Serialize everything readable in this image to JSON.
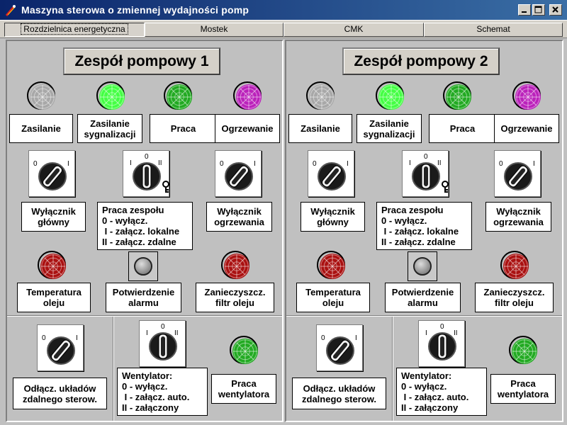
{
  "window": {
    "title": "Maszyna sterowa o zmiennej wydajności pomp"
  },
  "tabs": [
    {
      "label": "Rozdzielnica energetyczna",
      "active": true
    },
    {
      "label": "Mostek",
      "active": false
    },
    {
      "label": "CMK",
      "active": false
    },
    {
      "label": "Schemat",
      "active": false
    }
  ],
  "units": [
    {
      "title": "Zespół pompowy 1",
      "indicators": [
        {
          "label": "Zasilanie",
          "color": "#a8a8a8"
        },
        {
          "label": "Zasilanie sygnalizacji",
          "color": "#44ff44"
        },
        {
          "label": "Praca",
          "color": "#22aa22"
        },
        {
          "label": "Ogrzewanie",
          "color": "#bb22bb"
        }
      ],
      "main_switch_label": "Wyłącznik główny",
      "main_switch_positions": [
        "0",
        "I"
      ],
      "mode_switch_label": "Praca zespołu\n0 - wyłącz.\n I - załącz. lokalne\nII - załącz. zdalne",
      "mode_switch_positions": [
        "I",
        "0",
        "II"
      ],
      "heating_switch_label": "Wyłącznik ogrzewania",
      "heating_switch_positions": [
        "0",
        "I"
      ],
      "alarms": [
        {
          "label": "Temperatura oleju",
          "color": "#aa1111"
        },
        {
          "label": "Potwierdzenie alarmu"
        },
        {
          "label": "Zanieczyszcz. filtr oleju",
          "color": "#aa1111"
        }
      ],
      "remote_switch_label": "Odłącz. układów zdalnego sterow.",
      "remote_switch_positions": [
        "0",
        "I"
      ],
      "fan_switch_label": "Wentylator:\n0 - wyłącz.\n I - załącz. auto.\nII - załączony",
      "fan_switch_positions": [
        "I",
        "0",
        "II"
      ],
      "fan_lamp_label": "Praca wentylatora",
      "fan_lamp_color": "#22aa22"
    },
    {
      "title": "Zespół pompowy 2",
      "indicators": [
        {
          "label": "Zasilanie",
          "color": "#a8a8a8"
        },
        {
          "label": "Zasilanie sygnalizacji",
          "color": "#44ff44"
        },
        {
          "label": "Praca",
          "color": "#22aa22"
        },
        {
          "label": "Ogrzewanie",
          "color": "#bb22bb"
        }
      ],
      "main_switch_label": "Wyłącznik główny",
      "main_switch_positions": [
        "0",
        "I"
      ],
      "mode_switch_label": "Praca zespołu\n0 - wyłącz.\n I - załącz. lokalne\nII - załącz. zdalne",
      "mode_switch_positions": [
        "I",
        "0",
        "II"
      ],
      "heating_switch_label": "Wyłącznik ogrzewania",
      "heating_switch_positions": [
        "0",
        "I"
      ],
      "alarms": [
        {
          "label": "Temperatura oleju",
          "color": "#aa1111"
        },
        {
          "label": "Potwierdzenie alarmu"
        },
        {
          "label": "Zanieczyszcz. filtr oleju",
          "color": "#aa1111"
        }
      ],
      "remote_switch_label": "Odłącz. układów zdalnego sterow.",
      "remote_switch_positions": [
        "0",
        "I"
      ],
      "fan_switch_label": "Wentylator:\n0 - wyłącz.\n I - załącz. auto.\nII - załączony",
      "fan_switch_positions": [
        "I",
        "0",
        "II"
      ],
      "fan_lamp_label": "Praca wentylatora",
      "fan_lamp_color": "#22aa22"
    }
  ]
}
